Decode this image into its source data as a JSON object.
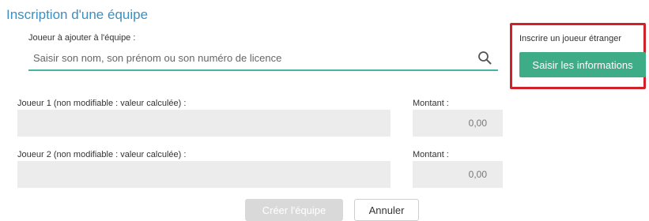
{
  "page": {
    "title": "Inscription d'une équipe"
  },
  "player_search": {
    "label": "Joueur à ajouter à l'équipe :",
    "placeholder": "Saisir son nom, son prénom ou son numéro de licence",
    "value": "",
    "icon": "search-icon"
  },
  "foreign_player": {
    "label": "Inscrire un joueur étranger",
    "button_label": "Saisir les informations",
    "highlight_color": "#d0202a",
    "button_color": "#3fac88"
  },
  "players": [
    {
      "label": "Joueur 1 (non modifiable : valeur calculée) :",
      "value": "",
      "amount_label": "Montant :",
      "amount": "0,00"
    },
    {
      "label": "Joueur 2 (non modifiable : valeur calculée) :",
      "value": "",
      "amount_label": "Montant :",
      "amount": "0,00"
    }
  ],
  "actions": {
    "create_label": "Créer l'équipe",
    "cancel_label": "Annuler"
  },
  "colors": {
    "title": "#3d8fc0",
    "input_underline": "#48b2a4",
    "field_bg": "#ececec"
  }
}
